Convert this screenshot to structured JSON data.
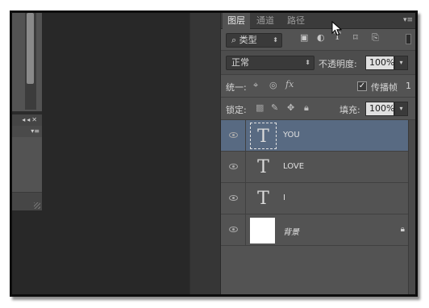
{
  "tabs": [
    {
      "label": "图层",
      "active": true
    },
    {
      "label": "通道",
      "active": false
    },
    {
      "label": "路径",
      "active": false
    }
  ],
  "panel_menu_icon": "panel-menu-icon",
  "filter": {
    "label": "类型",
    "icons": [
      "image-filter-icon",
      "adjustment-filter-icon",
      "type-filter-icon",
      "shape-filter-icon",
      "smart-object-filter-icon"
    ]
  },
  "blend": {
    "mode": "正常",
    "opacity_label": "不透明度:",
    "opacity_value": "100%"
  },
  "unify": {
    "label": "统一:",
    "propagate_label": "传播帧",
    "propagate_checked": true,
    "frame_number": "1"
  },
  "lock": {
    "label": "锁定:",
    "fill_label": "填充:",
    "fill_value": "100%"
  },
  "layers": [
    {
      "name": "YOU",
      "type": "text",
      "thumb_glyph": "T",
      "selected": true
    },
    {
      "name": "LOVE",
      "type": "text",
      "thumb_glyph": "T",
      "selected": false
    },
    {
      "name": "I",
      "type": "text",
      "thumb_glyph": "T",
      "selected": false
    },
    {
      "name": "背景",
      "type": "background",
      "thumb_glyph": "",
      "selected": false,
      "locked": true
    }
  ],
  "left_panel": {
    "collapse_glyph": "◂◂",
    "close_glyph": "✕",
    "menu_glyph": "▾≡"
  },
  "colors": {
    "panel_bg": "#535353",
    "selected_layer": "#586a82",
    "canvas_bg": "#282828"
  }
}
